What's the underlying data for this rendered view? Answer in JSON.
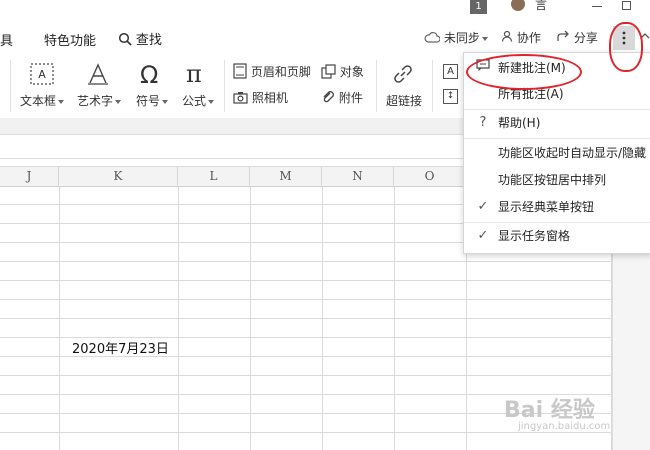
{
  "titlebar": {
    "badge": "1",
    "label": "言"
  },
  "tabs": [
    {
      "label": "具"
    },
    {
      "label": "特色功能"
    },
    {
      "label": "查找",
      "icon": "search-icon"
    }
  ],
  "header_right": {
    "sync": "未同步",
    "collab": "协作",
    "share": "分享",
    "more_icon": "more-vertical-icon"
  },
  "ribbon": {
    "textbox": "文本框",
    "art_text": "艺术字",
    "symbol": "符号",
    "formula": "公式",
    "header_footer": "页眉和页脚",
    "camera": "照相机",
    "object": "对象",
    "attachment": "附件",
    "hyperlink": "超链接"
  },
  "columns": [
    "J",
    "K",
    "L",
    "M",
    "N",
    "O"
  ],
  "cell_k": "2020年7月23日",
  "menu": {
    "new_comment": "新建批注(M)",
    "all_comments": "所有批注(A)",
    "help": "帮助(H)",
    "auto_show": "功能区收起时自动显示/隐藏",
    "center_buttons": "功能区按钮居中排列",
    "classic_menu": "显示经典菜单按钮",
    "task_pane": "显示任务窗格"
  },
  "watermark": {
    "line1": "Bai 经验",
    "line2": "jingyan.baidu.com"
  },
  "colors": {
    "accent_red": "#e0242b",
    "header_gray": "#f3f3f3"
  }
}
